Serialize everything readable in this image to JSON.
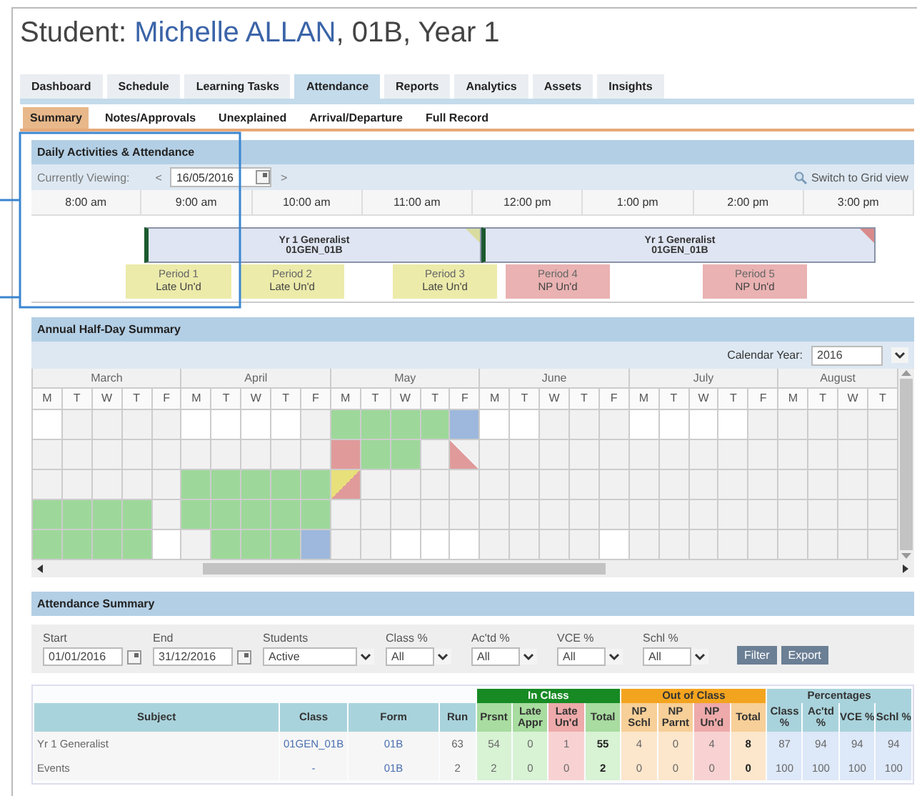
{
  "student": {
    "label": "Student: ",
    "name": "Michelle ALLAN",
    "details": ", 01B, Year 1"
  },
  "tabs": [
    {
      "label": "Dashboard",
      "selected": false
    },
    {
      "label": "Schedule",
      "selected": false
    },
    {
      "label": "Learning Tasks",
      "selected": false
    },
    {
      "label": "Attendance",
      "selected": true
    },
    {
      "label": "Reports",
      "selected": false
    },
    {
      "label": "Analytics",
      "selected": false
    },
    {
      "label": "Assets",
      "selected": false
    },
    {
      "label": "Insights",
      "selected": false
    }
  ],
  "subtabs": [
    {
      "label": "Summary",
      "selected": true
    },
    {
      "label": "Notes/Approvals",
      "selected": false
    },
    {
      "label": "Unexplained",
      "selected": false
    },
    {
      "label": "Arrival/Departure",
      "selected": false
    },
    {
      "label": "Full Record",
      "selected": false
    }
  ],
  "daily": {
    "title": "Daily Activities & Attendance",
    "viewing_label": "Currently Viewing:",
    "prev": "<",
    "date": "16/05/2016",
    "next": ">",
    "switch_link": "Switch to Grid view",
    "times": [
      "8:00 am",
      "9:00 am",
      "10:00 am",
      "11:00 am",
      "12:00 pm",
      "1:00 pm",
      "2:00 pm",
      "3:00 pm"
    ],
    "classes": [
      {
        "name": "Yr 1 Generalist",
        "code": "01GEN_01B",
        "kind": "late"
      },
      {
        "name": "Yr 1 Generalist",
        "code": "01GEN_01B",
        "kind": "absent"
      }
    ],
    "periods": [
      {
        "name": "Period 1",
        "status": "Late Un'd",
        "kind": "late"
      },
      {
        "name": "Period 2",
        "status": "Late Un'd",
        "kind": "late"
      },
      {
        "name": "Period 3",
        "status": "Late Un'd",
        "kind": "late"
      },
      {
        "name": "Period 4",
        "status": "NP Un'd",
        "kind": "absent"
      },
      {
        "name": "Period 5",
        "status": "NP Un'd",
        "kind": "absent"
      }
    ]
  },
  "annual": {
    "title": "Annual Half-Day Summary",
    "year_label": "Calendar Year:",
    "year": "2016",
    "months": [
      {
        "name": "March",
        "days": [
          "M",
          "T",
          "W",
          "T",
          "F"
        ]
      },
      {
        "name": "April",
        "days": [
          "M",
          "T",
          "W",
          "T",
          "F"
        ]
      },
      {
        "name": "May",
        "days": [
          "M",
          "T",
          "W",
          "T",
          "F"
        ]
      },
      {
        "name": "June",
        "days": [
          "M",
          "T",
          "W",
          "T",
          "F"
        ]
      },
      {
        "name": "July",
        "days": [
          "M",
          "T",
          "W",
          "T",
          "F"
        ]
      },
      {
        "name": "August",
        "days": [
          "M",
          "T",
          "W",
          "T"
        ]
      }
    ],
    "rows": [
      {
        "cells": [
          {
            "kind": "blank"
          },
          {
            "kind": "none"
          },
          {
            "kind": "none"
          },
          {
            "kind": "none"
          },
          {
            "kind": "none"
          },
          {
            "kind": "blank"
          },
          {
            "kind": "blank"
          },
          {
            "kind": "blank"
          },
          {
            "kind": "blank"
          },
          {
            "kind": "none"
          },
          {
            "kind": "present"
          },
          {
            "kind": "present"
          },
          {
            "kind": "present"
          },
          {
            "kind": "present"
          },
          {
            "kind": "other"
          },
          {
            "kind": "blank"
          },
          {
            "kind": "blank"
          },
          {
            "kind": "none"
          },
          {
            "kind": "none"
          },
          {
            "kind": "none"
          },
          {
            "kind": "blank"
          },
          {
            "kind": "blank"
          },
          {
            "kind": "blank"
          },
          {
            "kind": "blank"
          },
          {
            "kind": "none"
          },
          {
            "kind": "none"
          },
          {
            "kind": "none"
          },
          {
            "kind": "none"
          },
          {
            "kind": "none"
          }
        ]
      },
      {
        "cells": [
          {
            "kind": "none"
          },
          {
            "kind": "none"
          },
          {
            "kind": "none"
          },
          {
            "kind": "none"
          },
          {
            "kind": "none"
          },
          {
            "kind": "none"
          },
          {
            "kind": "none"
          },
          {
            "kind": "none"
          },
          {
            "kind": "none"
          },
          {
            "kind": "none"
          },
          {
            "kind": "absent"
          },
          {
            "kind": "present"
          },
          {
            "kind": "present"
          },
          {
            "kind": "none"
          },
          {
            "kind": "absent-half"
          },
          {
            "kind": "none"
          },
          {
            "kind": "none"
          },
          {
            "kind": "none"
          },
          {
            "kind": "none"
          },
          {
            "kind": "none"
          },
          {
            "kind": "none"
          },
          {
            "kind": "none"
          },
          {
            "kind": "none"
          },
          {
            "kind": "none"
          },
          {
            "kind": "none"
          },
          {
            "kind": "none"
          },
          {
            "kind": "none"
          },
          {
            "kind": "none"
          },
          {
            "kind": "none"
          }
        ]
      },
      {
        "cells": [
          {
            "kind": "none"
          },
          {
            "kind": "none"
          },
          {
            "kind": "none"
          },
          {
            "kind": "none"
          },
          {
            "kind": "none"
          },
          {
            "kind": "present"
          },
          {
            "kind": "present"
          },
          {
            "kind": "present"
          },
          {
            "kind": "present"
          },
          {
            "kind": "present"
          },
          {
            "kind": "late-absent"
          },
          {
            "kind": "none"
          },
          {
            "kind": "none"
          },
          {
            "kind": "none"
          },
          {
            "kind": "none"
          },
          {
            "kind": "none"
          },
          {
            "kind": "none"
          },
          {
            "kind": "none"
          },
          {
            "kind": "none"
          },
          {
            "kind": "none"
          },
          {
            "kind": "none"
          },
          {
            "kind": "none"
          },
          {
            "kind": "none"
          },
          {
            "kind": "none"
          },
          {
            "kind": "none"
          },
          {
            "kind": "none"
          },
          {
            "kind": "none"
          },
          {
            "kind": "none"
          },
          {
            "kind": "none"
          }
        ]
      },
      {
        "cells": [
          {
            "kind": "present"
          },
          {
            "kind": "present"
          },
          {
            "kind": "present"
          },
          {
            "kind": "present"
          },
          {
            "kind": "none"
          },
          {
            "kind": "present"
          },
          {
            "kind": "present"
          },
          {
            "kind": "present"
          },
          {
            "kind": "present"
          },
          {
            "kind": "present"
          },
          {
            "kind": "none"
          },
          {
            "kind": "none"
          },
          {
            "kind": "none"
          },
          {
            "kind": "none"
          },
          {
            "kind": "none"
          },
          {
            "kind": "none"
          },
          {
            "kind": "none"
          },
          {
            "kind": "none"
          },
          {
            "kind": "none"
          },
          {
            "kind": "none"
          },
          {
            "kind": "none"
          },
          {
            "kind": "none"
          },
          {
            "kind": "none"
          },
          {
            "kind": "none"
          },
          {
            "kind": "none"
          },
          {
            "kind": "none"
          },
          {
            "kind": "none"
          },
          {
            "kind": "none"
          },
          {
            "kind": "none"
          }
        ]
      },
      {
        "cells": [
          {
            "kind": "present"
          },
          {
            "kind": "present"
          },
          {
            "kind": "present"
          },
          {
            "kind": "present"
          },
          {
            "kind": "blank"
          },
          {
            "kind": "none"
          },
          {
            "kind": "present"
          },
          {
            "kind": "present"
          },
          {
            "kind": "present"
          },
          {
            "kind": "other"
          },
          {
            "kind": "none"
          },
          {
            "kind": "none"
          },
          {
            "kind": "blank"
          },
          {
            "kind": "blank"
          },
          {
            "kind": "blank"
          },
          {
            "kind": "none"
          },
          {
            "kind": "none"
          },
          {
            "kind": "none"
          },
          {
            "kind": "none"
          },
          {
            "kind": "blank"
          },
          {
            "kind": "none"
          },
          {
            "kind": "none"
          },
          {
            "kind": "none"
          },
          {
            "kind": "none"
          },
          {
            "kind": "none"
          },
          {
            "kind": "none"
          },
          {
            "kind": "none"
          },
          {
            "kind": "none"
          },
          {
            "kind": "none"
          }
        ]
      }
    ]
  },
  "summary": {
    "title": "Attendance Summary",
    "filters": [
      {
        "label": "Start",
        "value": "01/01/2016",
        "kind": "date"
      },
      {
        "label": "End",
        "value": "31/12/2016",
        "kind": "date"
      },
      {
        "label": "Students",
        "value": "Active",
        "kind": "select"
      },
      {
        "label": "Class %",
        "value": "All",
        "kind": "select"
      },
      {
        "label": "Ac'td %",
        "value": "All",
        "kind": "select"
      },
      {
        "label": "VCE %",
        "value": "All",
        "kind": "select"
      },
      {
        "label": "Schl %",
        "value": "All",
        "kind": "select"
      }
    ],
    "buttons": [
      "Filter",
      "Export"
    ],
    "table": {
      "columns": [
        {
          "label": "Subject",
          "kind": "text"
        },
        {
          "label": "Class",
          "kind": "link"
        },
        {
          "label": "Form",
          "kind": "link"
        },
        {
          "label": "Run",
          "kind": "plain"
        }
      ],
      "groups": [
        {
          "label": "In Class",
          "kind": "in",
          "columns": [
            {
              "label": "Prsnt",
              "kind": "present"
            },
            {
              "label": "Late Appr",
              "kind": "present"
            },
            {
              "label": "Late Un'd",
              "kind": "absent"
            },
            {
              "label": "Total",
              "kind": "total-in"
            }
          ]
        },
        {
          "label": "Out of Class",
          "kind": "out",
          "columns": [
            {
              "label": "NP Schl",
              "kind": "out"
            },
            {
              "label": "NP Parnt",
              "kind": "out"
            },
            {
              "label": "NP Un'd",
              "kind": "absent"
            },
            {
              "label": "Total",
              "kind": "total-out"
            }
          ]
        },
        {
          "label": "Percentages",
          "kind": "pct",
          "columns": [
            {
              "label": "Class %",
              "kind": "pct"
            },
            {
              "label": "Ac'td %",
              "kind": "pct"
            },
            {
              "label": "VCE %",
              "kind": "pct"
            },
            {
              "label": "Schl %",
              "kind": "pct"
            }
          ]
        }
      ],
      "rows": [
        {
          "cells": [
            "Yr 1 Generalist",
            "01GEN_01B",
            "01B",
            "63",
            "54",
            "0",
            "1",
            "55",
            "4",
            "0",
            "4",
            "8",
            "87",
            "94",
            "94",
            "94"
          ]
        },
        {
          "cells": [
            "Events",
            "-",
            "01B",
            "2",
            "2",
            "0",
            "0",
            "2",
            "0",
            "0",
            "0",
            "0",
            "100",
            "100",
            "100",
            "100"
          ]
        }
      ]
    }
  }
}
